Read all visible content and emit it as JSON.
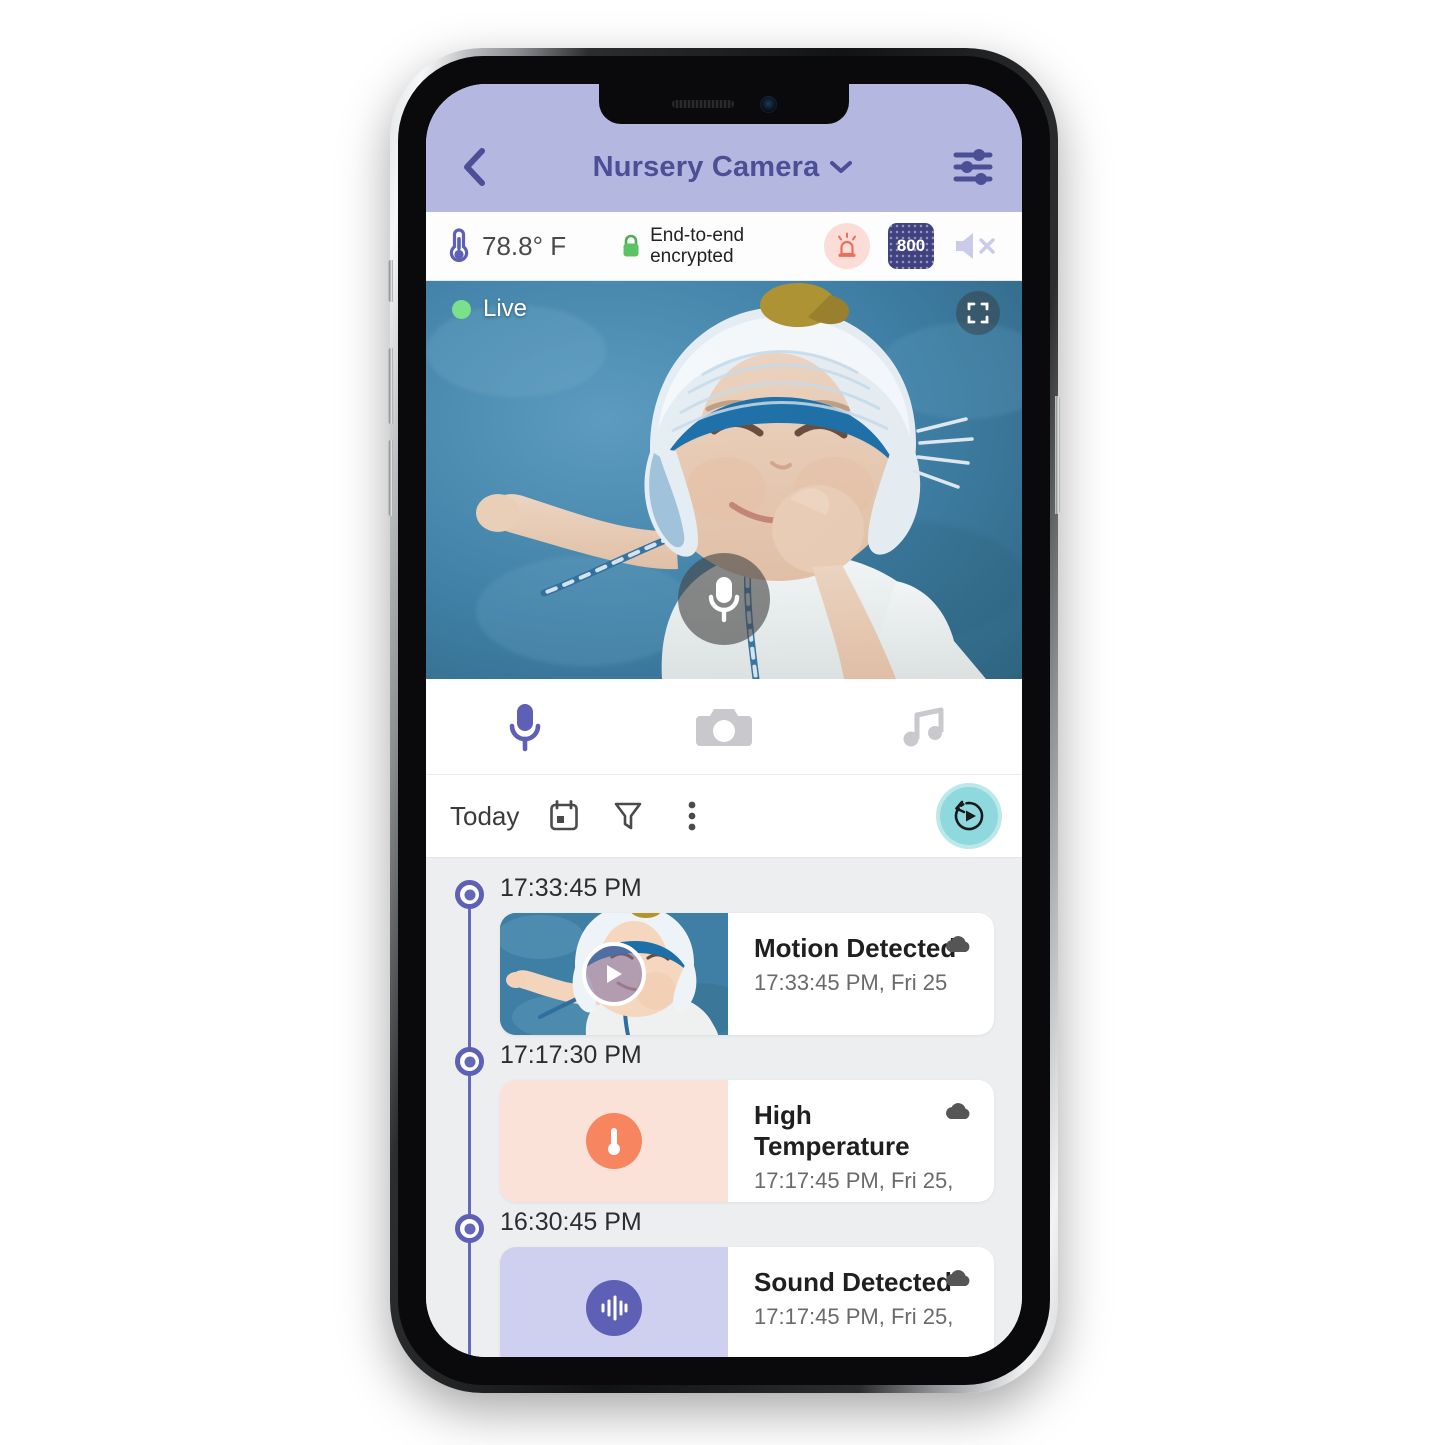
{
  "header": {
    "back_icon": "chevron-left-icon",
    "title": "Nursery Camera",
    "dropdown_icon": "chevron-down-icon",
    "settings_icon": "sliders-icon",
    "bg_color": "#b4b7e0",
    "title_color": "#4c4f96"
  },
  "status": {
    "temperature_icon": "thermometer-icon",
    "temperature": "78.8° F",
    "lock_icon": "lock-icon",
    "encryption_line1": "End-to-end",
    "encryption_line2": "encrypted",
    "alarm_icon": "siren-icon",
    "alarm_color": "#e8705a",
    "quality_badge": "800",
    "quality_badge_color": "#3f4180",
    "mute_icon": "speaker-mute-icon"
  },
  "video": {
    "live_label": "Live",
    "live_dot_color": "#7ae08a",
    "fullscreen_icon": "fullscreen-icon",
    "mic_icon": "microphone-icon"
  },
  "actions": [
    {
      "name": "talk-button",
      "icon": "microphone-icon",
      "color": "#5d60b5",
      "active": true
    },
    {
      "name": "snapshot-button",
      "icon": "camera-icon",
      "color": "#c9c9cd",
      "active": false
    },
    {
      "name": "lullaby-button",
      "icon": "music-note-icon",
      "color": "#c9c9cd",
      "active": false
    }
  ],
  "filter_bar": {
    "day_label": "Today",
    "calendar_icon": "calendar-icon",
    "filter_icon": "funnel-icon",
    "more_icon": "more-vertical-icon",
    "replay_icon": "replay-icon",
    "replay_color": "#8fd8dd"
  },
  "timeline": {
    "rail_color": "#6568bb",
    "events": [
      {
        "time": "17:33:45 PM",
        "title": "Motion Detected",
        "subtitle": "17:33:45 PM, Fri 25",
        "thumb_kind": "motion",
        "thumb_icon": "play-icon",
        "cloud_icon": "cloud-icon"
      },
      {
        "time": "17:17:30 PM",
        "title": "High Temperature",
        "subtitle": "17:17:45 PM, Fri 25,",
        "thumb_kind": "temp",
        "thumb_icon": "thermometer-icon",
        "cloud_icon": "cloud-icon"
      },
      {
        "time": "16:30:45 PM",
        "title": "Sound Detected",
        "subtitle": "17:17:45 PM, Fri 25,",
        "thumb_kind": "sound",
        "thumb_icon": "waveform-icon",
        "cloud_icon": "cloud-icon"
      }
    ]
  }
}
